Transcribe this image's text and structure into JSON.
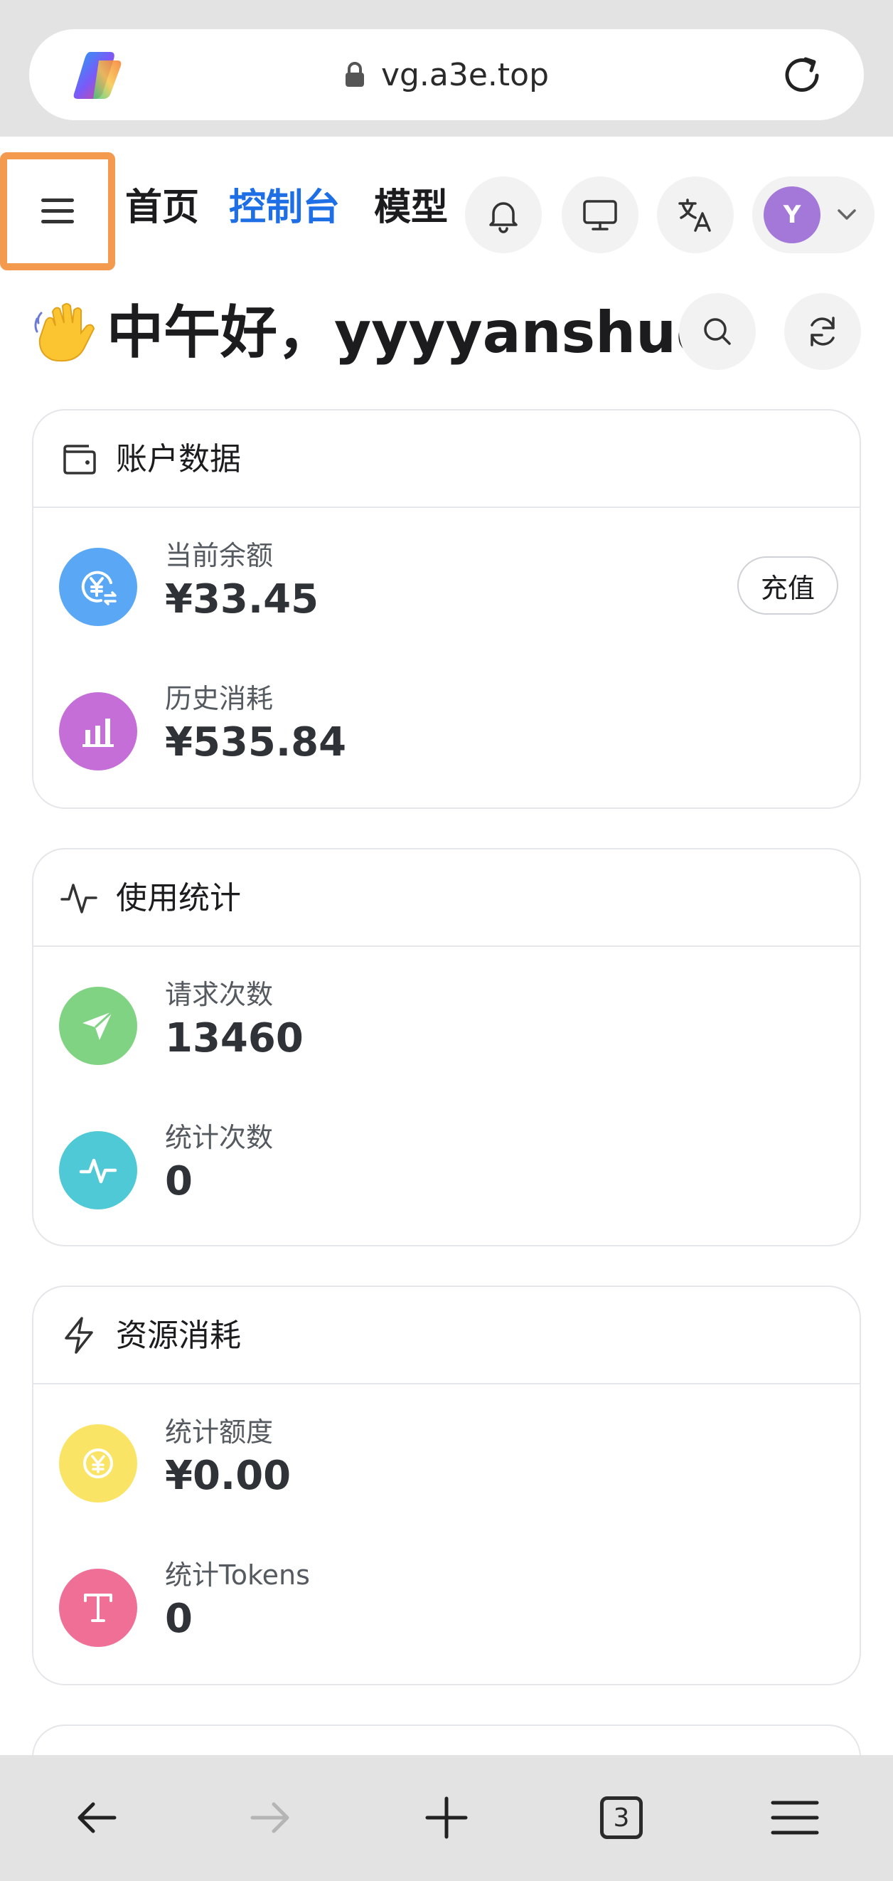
{
  "browser": {
    "url": "vg.a3e.top",
    "tab_count": "3"
  },
  "header": {
    "nav": {
      "home": "首页",
      "console": "控制台",
      "models": "模型"
    },
    "user": {
      "avatar_letter": "Y"
    }
  },
  "greeting": {
    "text": "中午好，yyyyanshuo"
  },
  "cards": {
    "account": {
      "title": "账户数据",
      "balance_label": "当前余额",
      "balance_value": "¥33.45",
      "recharge_label": "充值",
      "history_label": "历史消耗",
      "history_value": "¥535.84"
    },
    "usage": {
      "title": "使用统计",
      "requests_label": "请求次数",
      "requests_value": "13460",
      "stat_count_label": "统计次数",
      "stat_count_value": "0"
    },
    "resource": {
      "title": "资源消耗",
      "quota_label": "统计额度",
      "quota_value": "¥0.00",
      "tokens_label": "统计Tokens",
      "tokens_value": "0"
    }
  },
  "icons": {
    "browser_logo": "copilot-logo",
    "menu": "hamburger-icon",
    "bell": "bell-icon",
    "monitor": "monitor-icon",
    "translate": "translate-icon",
    "search": "search-icon",
    "refresh": "refresh-icon",
    "wallet": "wallet-icon",
    "activity": "activity-icon",
    "zap": "zap-icon"
  },
  "colors": {
    "accent": "#1e6fe6",
    "highlight_border": "#f39a4e",
    "balance_icon": "#5aa8f5",
    "history_icon": "#c66ed8",
    "requests_icon": "#7fd382",
    "stat_count_icon": "#4fc9d6",
    "quota_icon": "#fae466",
    "tokens_icon": "#f06f96",
    "avatar": "#a378d8"
  }
}
